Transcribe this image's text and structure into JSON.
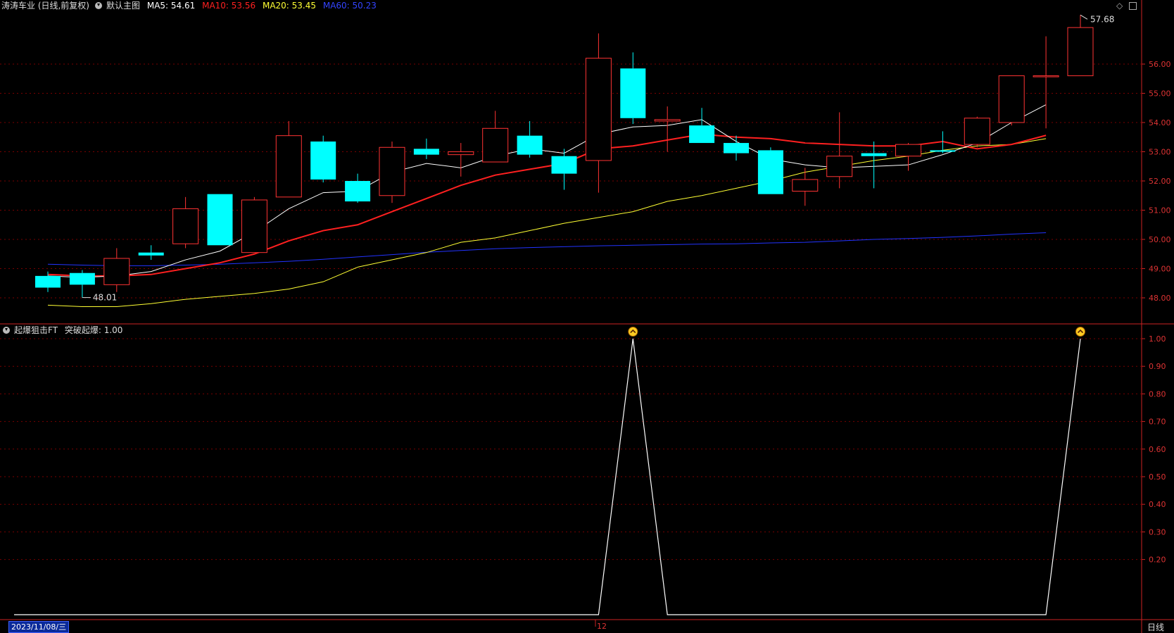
{
  "header": {
    "stock_title": "涛涛车业 (日线,前复权)",
    "main_indicator": "默认主图",
    "ma5_label": "MA5: 54.61",
    "ma10_label": "MA10: 53.56",
    "ma20_label": "MA20: 53.45",
    "ma60_label": "MA60: 50.23",
    "colors": {
      "ma5": "#ffffff",
      "ma10": "#ff2020",
      "ma20": "#ffff33",
      "ma60": "#2233ff"
    }
  },
  "sub_header": {
    "indicator_label": "起爆狙击FT",
    "value_label": "突破起爆: 1.00"
  },
  "footer": {
    "date": "2023/11/08/三",
    "month_tick": "12",
    "period": "日线"
  },
  "annotations": {
    "high": "57.68",
    "low": "48.01"
  },
  "colors": {
    "up": "#ff3333",
    "down": "#00ffff",
    "grid": "#7a0000",
    "axis": "#cc2222"
  },
  "chart_data": [
    {
      "type": "candlestick",
      "title": "涛涛车业 (日线,前复权)",
      "yticks": [
        48.0,
        49.0,
        50.0,
        51.0,
        52.0,
        53.0,
        54.0,
        55.0,
        56.0
      ],
      "ylim": [
        47.3,
        58.6
      ],
      "candles": [
        {
          "o": 48.75,
          "h": 48.9,
          "l": 48.2,
          "c": 48.35
        },
        {
          "o": 48.85,
          "h": 48.95,
          "l": 48.01,
          "c": 48.45
        },
        {
          "o": 48.45,
          "h": 49.7,
          "l": 48.2,
          "c": 49.35
        },
        {
          "o": 49.55,
          "h": 49.8,
          "l": 49.3,
          "c": 49.45
        },
        {
          "o": 49.85,
          "h": 51.45,
          "l": 49.7,
          "c": 51.05
        },
        {
          "o": 51.55,
          "h": 51.55,
          "l": 49.8,
          "c": 49.8
        },
        {
          "o": 49.55,
          "h": 51.45,
          "l": 49.55,
          "c": 51.35
        },
        {
          "o": 51.45,
          "h": 54.05,
          "l": 51.45,
          "c": 53.55
        },
        {
          "o": 53.35,
          "h": 53.55,
          "l": 51.95,
          "c": 52.05
        },
        {
          "o": 52.0,
          "h": 52.25,
          "l": 51.25,
          "c": 51.3
        },
        {
          "o": 51.5,
          "h": 53.35,
          "l": 51.25,
          "c": 53.15
        },
        {
          "o": 53.1,
          "h": 53.45,
          "l": 52.75,
          "c": 52.9
        },
        {
          "o": 52.9,
          "h": 53.3,
          "l": 52.15,
          "c": 53.0
        },
        {
          "o": 52.65,
          "h": 54.4,
          "l": 52.65,
          "c": 53.8
        },
        {
          "o": 53.55,
          "h": 54.05,
          "l": 52.8,
          "c": 52.9
        },
        {
          "o": 52.85,
          "h": 53.1,
          "l": 51.7,
          "c": 52.25
        },
        {
          "o": 52.7,
          "h": 57.05,
          "l": 51.6,
          "c": 56.2
        },
        {
          "o": 55.85,
          "h": 56.4,
          "l": 53.95,
          "c": 54.15
        },
        {
          "o": 54.05,
          "h": 54.55,
          "l": 53.0,
          "c": 54.1
        },
        {
          "o": 53.9,
          "h": 54.5,
          "l": 53.3,
          "c": 53.3
        },
        {
          "o": 53.3,
          "h": 53.55,
          "l": 52.7,
          "c": 52.95
        },
        {
          "o": 53.05,
          "h": 53.15,
          "l": 51.55,
          "c": 51.55
        },
        {
          "o": 51.65,
          "h": 52.45,
          "l": 51.15,
          "c": 52.05
        },
        {
          "o": 52.15,
          "h": 54.35,
          "l": 51.75,
          "c": 52.85
        },
        {
          "o": 52.95,
          "h": 53.35,
          "l": 51.75,
          "c": 52.85
        },
        {
          "o": 52.85,
          "h": 53.3,
          "l": 52.35,
          "c": 53.25
        },
        {
          "o": 53.05,
          "h": 53.7,
          "l": 52.95,
          "c": 53.0
        },
        {
          "o": 53.25,
          "h": 54.2,
          "l": 53.15,
          "c": 54.15
        },
        {
          "o": 54.0,
          "h": 55.2,
          "l": 53.9,
          "c": 55.6
        },
        {
          "o": 55.6,
          "h": 56.95,
          "l": 53.8,
          "c": 55.6
        },
        {
          "o": 55.6,
          "h": 57.68,
          "l": 55.6,
          "c": 57.25
        }
      ],
      "ma5": [
        48.75,
        48.7,
        48.75,
        48.9,
        49.3,
        49.6,
        50.25,
        51.05,
        51.6,
        51.65,
        52.3,
        52.6,
        52.45,
        52.85,
        53.1,
        52.95,
        53.6,
        53.85,
        53.9,
        54.1,
        53.35,
        52.75,
        52.55,
        52.45,
        52.5,
        52.55,
        52.9,
        53.3,
        54.0,
        54.61
      ],
      "ma10": [
        48.8,
        48.75,
        48.75,
        48.8,
        49.0,
        49.2,
        49.5,
        49.95,
        50.3,
        50.5,
        50.95,
        51.4,
        51.85,
        52.2,
        52.4,
        52.6,
        53.1,
        53.2,
        53.4,
        53.6,
        53.5,
        53.45,
        53.3,
        53.25,
        53.2,
        53.2,
        53.35,
        53.1,
        53.25,
        53.56
      ],
      "ma20": [
        47.75,
        47.7,
        47.7,
        47.8,
        47.95,
        48.05,
        48.15,
        48.3,
        48.55,
        49.05,
        49.3,
        49.55,
        49.9,
        50.05,
        50.3,
        50.55,
        50.75,
        50.95,
        51.3,
        51.5,
        51.75,
        52.0,
        52.3,
        52.5,
        52.7,
        52.85,
        53.05,
        53.2,
        53.25,
        53.45
      ],
      "ma60": [
        49.15,
        49.12,
        49.1,
        49.1,
        49.12,
        49.15,
        49.2,
        49.25,
        49.32,
        49.4,
        49.48,
        49.56,
        49.62,
        49.68,
        49.72,
        49.75,
        49.78,
        49.8,
        49.82,
        49.84,
        49.85,
        49.88,
        49.9,
        49.95,
        50.0,
        50.03,
        50.07,
        50.12,
        50.18,
        50.23
      ]
    },
    {
      "type": "line",
      "title": "起爆狙击FT",
      "yticks": [
        0.2,
        0.3,
        0.4,
        0.5,
        0.6,
        0.7,
        0.8,
        0.9,
        1.0
      ],
      "ylim": [
        0,
        1.08
      ],
      "values": [
        0,
        0,
        0,
        0,
        0,
        0,
        0,
        0,
        0,
        0,
        0,
        0,
        0,
        0,
        0,
        0,
        0,
        1,
        0,
        0,
        0,
        0,
        0,
        0,
        0,
        0,
        0,
        0,
        0,
        0,
        1
      ],
      "signal_points": [
        17,
        30
      ]
    }
  ]
}
